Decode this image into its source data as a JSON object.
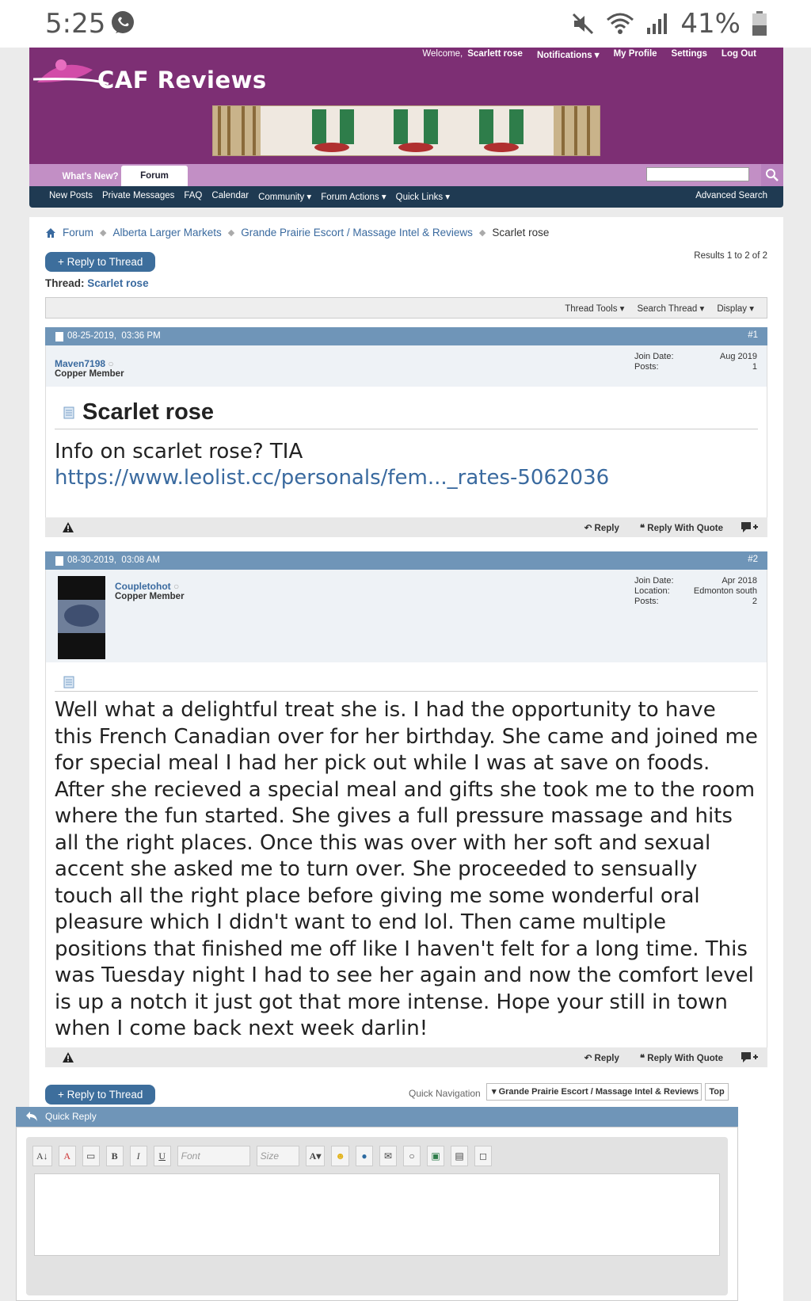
{
  "status_bar": {
    "time": "5:25",
    "battery_pct": "41%"
  },
  "header": {
    "logo_text": "CAF Reviews",
    "welcome_label": "Welcome,",
    "username": "Scarlett rose",
    "notifications": "Notifications",
    "my_profile": "My Profile",
    "settings": "Settings",
    "logout": "Log Out"
  },
  "nav": {
    "tab_whats_new": "What's New?",
    "tab_forum": "Forum",
    "sub_items": [
      "New Posts",
      "Private Messages",
      "FAQ",
      "Calendar",
      "Community",
      "Forum Actions",
      "Quick Links"
    ],
    "advanced_search": "Advanced Search"
  },
  "breadcrumb": [
    "Forum",
    "Alberta Larger Markets",
    "Grande Prairie Escort / Massage Intel & Reviews",
    "Scarlet rose"
  ],
  "reply_to_thread": "+ Reply to Thread",
  "results": "Results 1 to 2 of 2",
  "thread": {
    "label": "Thread:",
    "title": "Scarlet rose"
  },
  "thread_tools": [
    "Thread Tools",
    "Search Thread",
    "Display"
  ],
  "posts": [
    {
      "date": "08-25-2019,",
      "time": "03:36 PM",
      "number": "#1",
      "username": "Maven7198",
      "rank": "Copper Member",
      "stats": [
        [
          "Join Date:",
          "Aug 2019"
        ],
        [
          "Posts:",
          "1"
        ]
      ],
      "title": "Scarlet rose",
      "text": "Info on scarlet rose? TIA",
      "link": "https://www.leolist.cc/personals/fem..._rates-5062036"
    },
    {
      "date": "08-30-2019,",
      "time": "03:08 AM",
      "number": "#2",
      "username": "Coupletohot",
      "rank": "Copper Member",
      "stats": [
        [
          "Join Date:",
          "Apr 2018"
        ],
        [
          "Location:",
          "Edmonton south"
        ],
        [
          "Posts:",
          "2"
        ]
      ],
      "text": "Well what a delightful treat she is. I had the opportunity to have this French Canadian over for her birthday. She came and joined me for special meal I had her pick out while I was at save on foods. After she recieved a special meal and gifts she took me to the room where the fun started. She gives a full pressure massage and hits all the right places. Once this was over with her soft and sexual accent she asked me to turn over. She proceeded to sensually touch all the right place before giving me some wonderful oral pleasure which I didn't want to end lol. Then came multiple positions that finished me off like I haven't felt for a long time. This was Tuesday night I had to see her again and now the comfort level is up a notch it just got that more intense. Hope your still in town when I come back next week darlin!"
    }
  ],
  "post_actions": {
    "reply": "Reply",
    "reply_with_quote": "Reply With Quote"
  },
  "quick_nav": {
    "label": "Quick Navigation",
    "selected": "Grande Prairie Escort / Massage Intel & Reviews",
    "top": "Top"
  },
  "quick_reply": {
    "title": "Quick Reply",
    "font_placeholder": "Font",
    "size_placeholder": "Size"
  },
  "colors": {
    "header_purple": "#7d2f74",
    "nav_lilac": "#c28fc5",
    "subnav_navy": "#1f3a52",
    "post_head_blue": "#6f95b8",
    "link_blue": "#3a6a9f"
  }
}
